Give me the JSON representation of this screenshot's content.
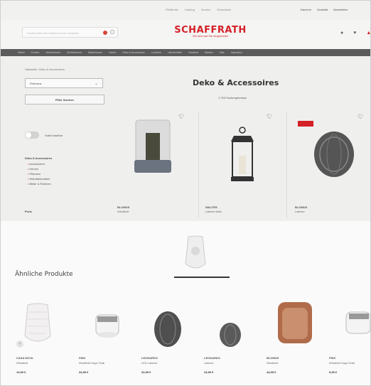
{
  "top_links": [
    "Filialfinder",
    "Katalog",
    "Service",
    "Gutscheine"
  ],
  "top_right_links": [
    "Karriere",
    "Kontakt",
    "Newsletter"
  ],
  "search": {
    "placeholder": "Suchbegriff oder Artikelnummer eingeben"
  },
  "logo": {
    "name": "SCHAFFRATH",
    "tagline": "Wir sind auf Sie eingerichtet"
  },
  "nav_items": [
    "Möbel",
    "Küchen",
    "Wohnzimmer",
    "Schlafzimmer",
    "Badezimmer",
    "Garten",
    "Deko & Accessoires",
    "Leuchten",
    "Heimtextilien",
    "Haushalt",
    "Marken",
    "Sale",
    "Inspiration"
  ],
  "breadcrumb": "Startseite / Deko & Accessoires",
  "sort_select": {
    "value": "Relevanz"
  },
  "filter_button": "Filter löschen",
  "category": {
    "title": "Deko & Accessoires",
    "count": "1.753 Suchergebnisse"
  },
  "toggle_label": "Sofort kaufbar",
  "sidebar": {
    "title": "Deko & Accessoires",
    "links": [
      "Accessoires",
      "Kerzen",
      "Pflanzen",
      "Wanddekoration",
      "Bilder & Rahmen"
    ]
  },
  "price_label": "Preis",
  "products": [
    {
      "brand": "BLOMUS",
      "name": "Windlicht"
    },
    {
      "brand": "WALTER",
      "name": "Laterne klein"
    },
    {
      "brand": "BLOMUS",
      "name": "Laterne"
    }
  ],
  "similar": {
    "title": "Ähnliche Produkte",
    "items": [
      {
        "brand": "CASA NOVA",
        "name": "Windlicht",
        "price": "14,99 €"
      },
      {
        "brand": "FINK",
        "name": "Windlicht Kaya Teak",
        "price": "34,95 €"
      },
      {
        "brand": "LEONARDO",
        "name": "LED Laterne",
        "price": "32,99 €"
      },
      {
        "brand": "LEONARDO",
        "name": "Laterne",
        "price": "24,99 €"
      },
      {
        "brand": "BLOMUS",
        "name": "Windlicht",
        "price": "44,95 €"
      },
      {
        "brand": "FINK",
        "name": "Windlicht Kaya Teak",
        "price": "9,99 €"
      }
    ]
  },
  "colors": {
    "brand_red": "#d42027",
    "nav_bg": "#5b5b5b"
  },
  "icons": [
    "search-icon",
    "user-icon",
    "heart-icon",
    "cart-icon",
    "chevron-down-icon",
    "chevron-left-icon"
  ]
}
